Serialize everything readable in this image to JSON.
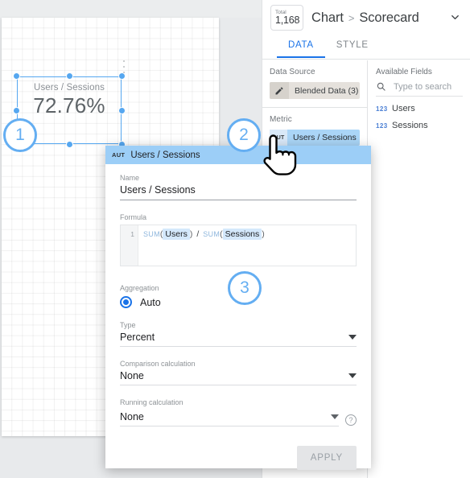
{
  "canvas": {
    "scorecard": {
      "label": "Users / Sessions",
      "value": "72.76%",
      "menu_icon": "more-vert-icon"
    }
  },
  "badges": {
    "one": "1",
    "two": "2",
    "three": "3"
  },
  "panel": {
    "total_chip": {
      "label": "Total",
      "value": "1,168"
    },
    "breadcrumb": {
      "root": "Chart",
      "separator": ">",
      "current": "Scorecard"
    },
    "collapse_icon": "chevron-down-icon",
    "tabs": [
      {
        "label": "DATA",
        "active": true
      },
      {
        "label": "STYLE",
        "active": false
      }
    ],
    "data_source": {
      "title": "Data Source",
      "icon": "pencil-icon",
      "name": "Blended Data (3)"
    },
    "metric": {
      "title": "Metric",
      "badge": "AUT",
      "name": "Users / Sessions"
    },
    "available_fields": {
      "title": "Available Fields",
      "search_icon": "search-icon",
      "search_placeholder": "Type to search",
      "search_value": "",
      "fields": [
        {
          "type": "123",
          "name": "Users"
        },
        {
          "type": "123",
          "name": "Sessions"
        }
      ]
    }
  },
  "dialog": {
    "header": {
      "badge": "AUT",
      "title": "Users / Sessions"
    },
    "name": {
      "label": "Name",
      "value": "Users / Sessions"
    },
    "formula": {
      "label": "Formula",
      "line_number": "1",
      "fn1": "SUM",
      "open1": "(",
      "token1": "Users",
      "close1": ")",
      "operator": "/",
      "fn2": "SUM",
      "open2": "(",
      "token2": "Sessions",
      "close2": ")"
    },
    "aggregation": {
      "label": "Aggregation",
      "option": "Auto",
      "selected": true
    },
    "type": {
      "label": "Type",
      "value": "Percent",
      "caret_icon": "caret-down-icon"
    },
    "comparison": {
      "label": "Comparison calculation",
      "value": "None",
      "caret_icon": "caret-down-icon"
    },
    "running": {
      "label": "Running calculation",
      "value": "None",
      "caret_icon": "caret-down-icon",
      "help_icon": "help-circle-icon"
    },
    "apply_label": "APPLY"
  },
  "cursor": {
    "icon": "pointing-hand-cursor"
  },
  "colors": {
    "accent_blue": "#1a73e8",
    "badge_blue": "#64aef2",
    "selection_blue": "#56a7f0",
    "metric_chip": "#aad5f7",
    "dialog_header": "#9ccef7"
  }
}
